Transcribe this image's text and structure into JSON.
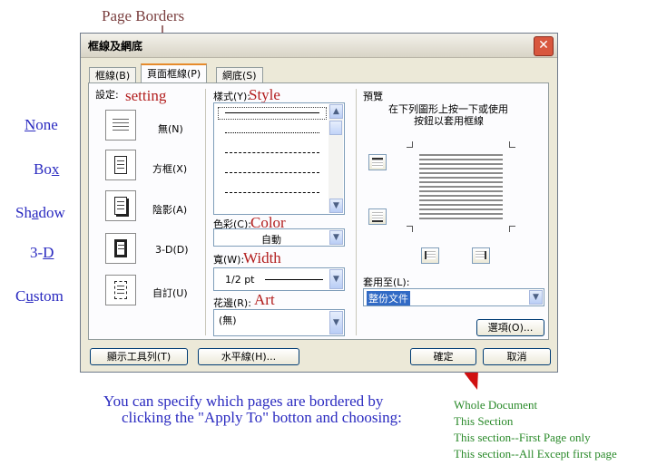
{
  "annotations": {
    "page_borders": "Page Borders",
    "setting": "setting",
    "style": "Style",
    "color": "Color",
    "width": "Width",
    "art": "Art",
    "bottom_line1": "You can specify which pages are bordered by",
    "bottom_line2": "clicking the \"Apply To\" botton and choosing:",
    "choices": [
      "Whole Document",
      "This Section",
      "This section--First Page only",
      "This section--All Except first page"
    ]
  },
  "left_labels": [
    "None",
    "Box",
    "Shadow",
    "3-D",
    "Custom"
  ],
  "dialog": {
    "title": "框線及網底",
    "tabs": [
      "框線(B)",
      "頁面框線(P)",
      "網底(S)"
    ],
    "setting_label": "設定:",
    "settings": [
      "無(N)",
      "方框(X)",
      "陰影(A)",
      "3-D(D)",
      "自訂(U)"
    ],
    "style_label": "樣式(Y):",
    "color_label": "色彩(C):",
    "color_value": "自動",
    "width_label": "寬(W):",
    "width_value": "1/2 pt",
    "art_label": "花邊(R):",
    "art_value": "(無)",
    "preview_label": "預覽",
    "preview_hint_1": "在下列圖形上按一下或使用",
    "preview_hint_2": "按鈕以套用框線",
    "apply_label": "套用至(L):",
    "apply_value": "整份文件",
    "options_button": "選項(O)...",
    "toolbar_button": "顯示工具列(T)",
    "hline_button": "水平線(H)...",
    "ok_button": "確定",
    "cancel_button": "取消"
  },
  "colors": {
    "annotation_red": "#b21d1d",
    "left_blue": "#2a2ac0",
    "choice_green": "#2a8a2a",
    "tab_highlight": "#e68b2c"
  }
}
